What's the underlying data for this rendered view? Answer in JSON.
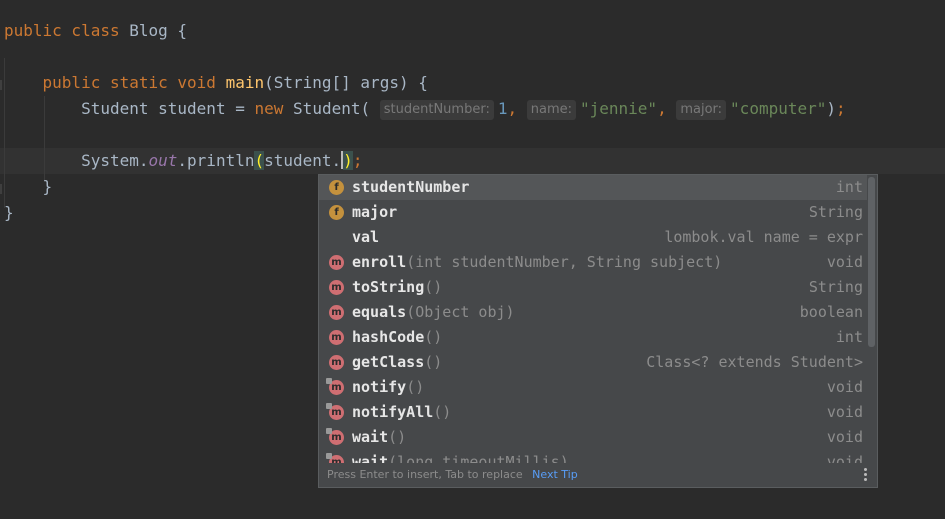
{
  "code": {
    "line1": {
      "kw": "public class",
      "name": "Blog",
      "brace": "{"
    },
    "line2": {
      "kw": "public static void",
      "fn": "main",
      "params": "(String[] args) {"
    },
    "line3": {
      "type": "Student",
      "var": "student",
      "eq": "=",
      "kw_new": "new",
      "ctor": "Student(",
      "hint1": "studentNumber:",
      "arg1": "1",
      "comma1": ",",
      "hint2": "name:",
      "arg2": "\"jennie\"",
      "comma2": ",",
      "hint3": "major:",
      "arg3": "\"computer\"",
      "close": ")",
      "semi": ";"
    },
    "line4": {
      "obj": "System.",
      "field": "out",
      "call": ".println",
      "paren_open": "(",
      "arg": "student.",
      "paren_close": ")",
      "semi": ";"
    },
    "line5": {
      "brace": "}"
    },
    "line6": {
      "brace": "}"
    }
  },
  "completion": {
    "items": [
      {
        "kind": "f",
        "name": "studentNumber",
        "tail": "",
        "type": "int",
        "selected": true
      },
      {
        "kind": "f",
        "name": "major",
        "tail": "",
        "type": "String"
      },
      {
        "kind": "",
        "name": "val",
        "tail": "",
        "type": "lombok.val name = expr"
      },
      {
        "kind": "m",
        "name": "enroll",
        "tail": "(int studentNumber, String subject)",
        "type": "void"
      },
      {
        "kind": "m",
        "name": "toString",
        "tail": "()",
        "type": "String"
      },
      {
        "kind": "m",
        "name": "equals",
        "tail": "(Object obj)",
        "type": "boolean"
      },
      {
        "kind": "m",
        "name": "hashCode",
        "tail": "()",
        "type": "int"
      },
      {
        "kind": "m",
        "name": "getClass",
        "tail": "()",
        "type": "Class<? extends Student>"
      },
      {
        "kind": "m-lock",
        "name": "notify",
        "tail": "()",
        "type": "void"
      },
      {
        "kind": "m-lock",
        "name": "notifyAll",
        "tail": "()",
        "type": "void"
      },
      {
        "kind": "m-lock",
        "name": "wait",
        "tail": "()",
        "type": "void"
      },
      {
        "kind": "m-lock",
        "name": "wait",
        "tail": "(long timeoutMillis)",
        "type": "void"
      }
    ],
    "footer": {
      "hint": "Press Enter to insert, Tab to replace",
      "link": "Next Tip"
    }
  },
  "colors": {
    "background": "#2b2b2b",
    "keyword": "#cc7832",
    "function": "#ffc66d",
    "string": "#6a8759",
    "number": "#6897bb",
    "field_badge": "#c4913d",
    "method_badge": "#cf6e72",
    "link": "#589df6"
  }
}
